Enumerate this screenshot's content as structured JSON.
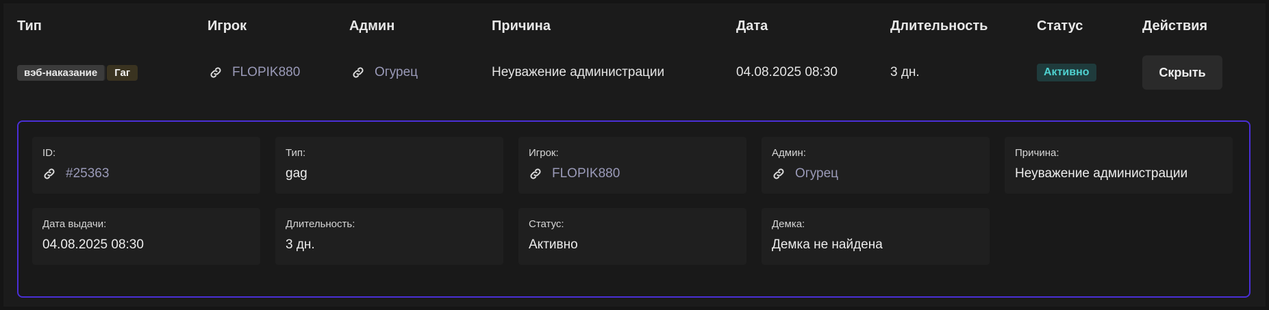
{
  "table": {
    "headers": [
      "Тип",
      "Игрок",
      "Админ",
      "Причина",
      "Дата",
      "Длительность",
      "Статус",
      "Действия"
    ]
  },
  "row": {
    "type_tag": "вэб-наказание",
    "kind_tag": "Гаг",
    "player": "FLOPIK880",
    "admin": "Огурец",
    "reason": "Неуважение администрации",
    "date": "04.08.2025 08:30",
    "duration": "3 дн.",
    "status": "Активно",
    "action_label": "Скрыть"
  },
  "details": {
    "id_label": "ID:",
    "id_value": "#25363",
    "type_label": "Тип:",
    "type_value": "gag",
    "player_label": "Игрок:",
    "player_value": "FLOPIK880",
    "admin_label": "Админ:",
    "admin_value": "Огурец",
    "reason_label": "Причина:",
    "reason_value": "Неуважение администрации",
    "date_label": "Дата выдачи:",
    "date_value": "04.08.2025 08:30",
    "duration_label": "Длительность:",
    "duration_value": "3 дн.",
    "status_label": "Статус:",
    "status_value": "Активно",
    "demo_label": "Демка:",
    "demo_value": "Демка не найдена"
  },
  "icons": {
    "link": "link-icon"
  },
  "colors": {
    "accent_border": "#4a2fd6",
    "link": "#9a9ab8",
    "status_active": "#4fd1cf"
  }
}
